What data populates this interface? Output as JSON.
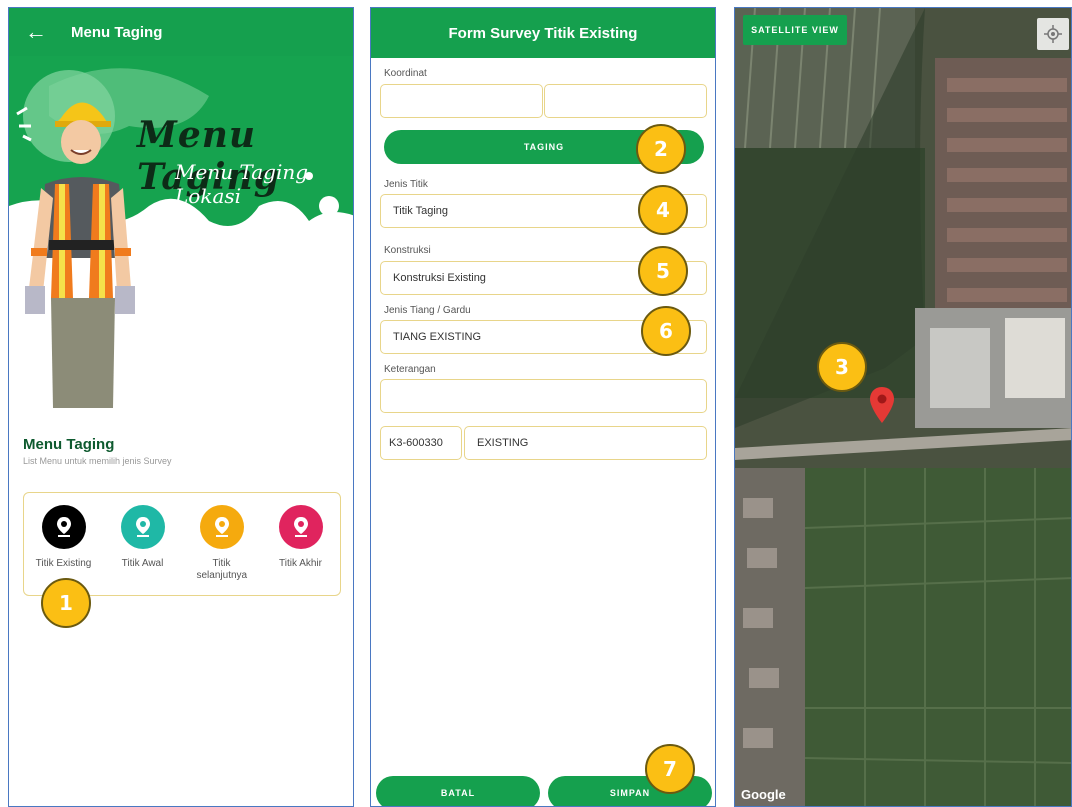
{
  "screen1": {
    "appbar": {
      "back": "←",
      "title": "Menu Taging"
    },
    "hero": {
      "title": "Menu Taging",
      "subtitle": "Menu Taging Lokasi"
    },
    "menu": {
      "title": "Menu Taging",
      "subtitle": "List Menu untuk memilih jenis Survey",
      "items": [
        {
          "label": "Titik Existing",
          "color": "#000000"
        },
        {
          "label": "Titik Awal",
          "color": "#1fb8a6"
        },
        {
          "label": "Titik selanjutnya",
          "color": "#f5aa0e"
        },
        {
          "label": "Titik Akhir",
          "color": "#e0245e"
        }
      ]
    }
  },
  "screen2": {
    "title": "Form Survey Titik Existing",
    "koordinat_label": "Koordinat",
    "koordinat_lat": "",
    "koordinat_lng": "",
    "taging_button": "TAGING",
    "jenis_titik_label": "Jenis Titik",
    "jenis_titik_value": "Titik Taging",
    "konstruksi_label": "Konstruksi",
    "konstruksi_value": "Konstruksi Existing",
    "jenis_tiang_label": "Jenis Tiang / Gardu",
    "jenis_tiang_value": "TIANG EXISTING",
    "keterangan_label": "Keterangan",
    "keterangan_value": "",
    "kode": "K3-600330",
    "status": "EXISTING",
    "batal": "BATAL",
    "simpan": "SIMPAN"
  },
  "screen3": {
    "satellite_button": "SATELLITE VIEW",
    "google": "Google"
  },
  "badges": [
    "1",
    "2",
    "3",
    "4",
    "5",
    "6",
    "7"
  ],
  "colors": {
    "primary": "#15a04e",
    "badge": "#fbbf14",
    "field_border": "#e8d58a"
  }
}
